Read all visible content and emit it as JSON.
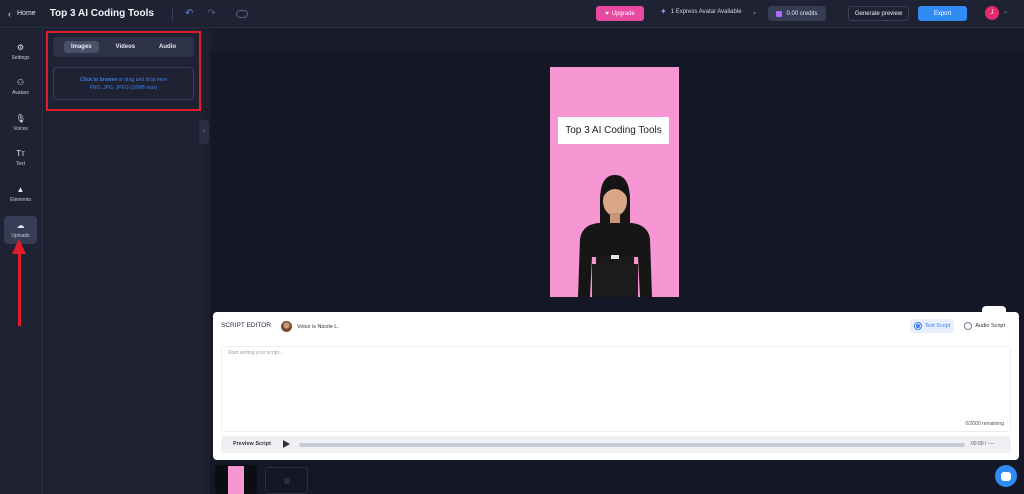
{
  "topbar": {
    "home_label": "Home",
    "title": "Top 3 AI Coding Tools",
    "upgrade_label": "Upgrade",
    "express_label": "1 Express Avatar Available",
    "credits_label": "0.00 credits",
    "generate_preview_label": "Generate preview",
    "export_label": "Export",
    "avatar_initial": "J",
    "colors": {
      "upgrade": "#e94aa1",
      "export": "#2f8cf5",
      "avatar": "#e42a6d"
    }
  },
  "sidebar": {
    "items": [
      {
        "label": "Settings",
        "icon": "gear-icon",
        "glyph": "⚙"
      },
      {
        "label": "Avatars",
        "icon": "people-icon",
        "glyph": "👥"
      },
      {
        "label": "Voices",
        "icon": "microphone-icon",
        "glyph": "🎙"
      },
      {
        "label": "Text",
        "icon": "text-icon",
        "glyph": "Tт"
      },
      {
        "label": "Elements",
        "icon": "shapes-icon",
        "glyph": "▲"
      },
      {
        "label": "Uploads",
        "icon": "cloud-upload-icon",
        "glyph": "☁"
      }
    ],
    "active": "Uploads"
  },
  "upload_panel": {
    "tabs": [
      "Images",
      "Videos",
      "Audio"
    ],
    "active_tab": "Images",
    "dropzone_link": "Click to browse",
    "dropzone_text": " or drag and drop here",
    "dropzone_formats": "PNG, JPG, JPEG (20MB max)"
  },
  "canvas": {
    "title_text": "Top 3 AI Coding Tools",
    "background_color": "#f696d2"
  },
  "script_editor": {
    "heading": "SCRIPT EDITOR",
    "voice_label": "Voice is Nicole L.",
    "modes": [
      "Text Script",
      "Audio Script"
    ],
    "active_mode": "Text Script",
    "placeholder": "Start writing your script...",
    "remaining": "0/2000 remaining",
    "preview_label": "Preview Script",
    "time": "00:00 / ----"
  }
}
